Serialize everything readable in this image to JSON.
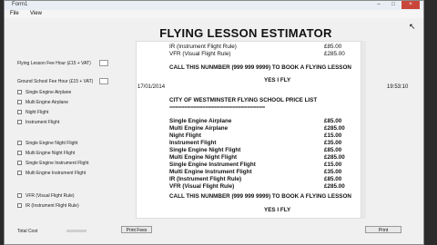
{
  "window": {
    "title": "Form1",
    "controls": [
      "–",
      "□",
      "×"
    ]
  },
  "menu": [
    "File",
    "View"
  ],
  "heading": "FLYING LESSON ESTIMATOR",
  "left_panel": {
    "flying_rate_label": "Flying Lesson Fee Hour (£15 + VAT)",
    "ground_rate_label": "Ground School Fee Hour (£15 + VAT)",
    "group1": [
      "Single Engine Airplane",
      "Multi Engine Airplane",
      "Night Flight",
      "Instrument Flight"
    ],
    "group2": [
      "Single Engine Night Flight",
      "Multi Engine Night Flight",
      "Single Engine Instrument Flight",
      "Multi Engine Instrument Flight"
    ],
    "group3": [
      "VFR (Visual Flight Rule)",
      "IR (Instrument Flight Rule)"
    ],
    "total_label": "Total Cost"
  },
  "buttons": {
    "print_fees": "Print Fees",
    "print": "Print"
  },
  "output": {
    "top_items": [
      {
        "name": "IR (Instrument Flight Rule)",
        "price": "£85.00"
      },
      {
        "name": "VFR (Visual Flight Rule)",
        "price": "£285.00"
      }
    ],
    "call_line": "CALL THIS NUNMBER (999 999 9999) TO BOOK A FLYING LESSON",
    "yes_line": "YES I FLY",
    "date": "17/01/2014",
    "time": "19:53:10",
    "school_title": "CITY OF WESTMINSTER FLYING SCHOOL PRICE LIST",
    "divider": "================================",
    "price_list": [
      {
        "name": "Single Engine Airplane",
        "price": "£85.00"
      },
      {
        "name": "Multi Engine Airplane",
        "price": "£285.00"
      },
      {
        "name": "Night Flight",
        "price": "£15.00"
      },
      {
        "name": "Instrument Flight",
        "price": "£35.00"
      },
      {
        "name": "Single Engine Night Flight",
        "price": "£85.00"
      },
      {
        "name": "Multi Engine Night Flight",
        "price": "£285.00"
      },
      {
        "name": "Single Engine Instrument Flight",
        "price": "£15.00"
      },
      {
        "name": "Multi Engine Instrument Flight",
        "price": "£35.00"
      },
      {
        "name": "IR (Instrument Flight Rule)",
        "price": "£85.00"
      },
      {
        "name": "VFR (Visual Flight Rule)",
        "price": "£285.00"
      }
    ],
    "call_line_2": "CALL THIS NUNMBER (999 999 9999) TO BOOK A FLYING LESSON",
    "yes_line_2": "YES I FLY"
  }
}
